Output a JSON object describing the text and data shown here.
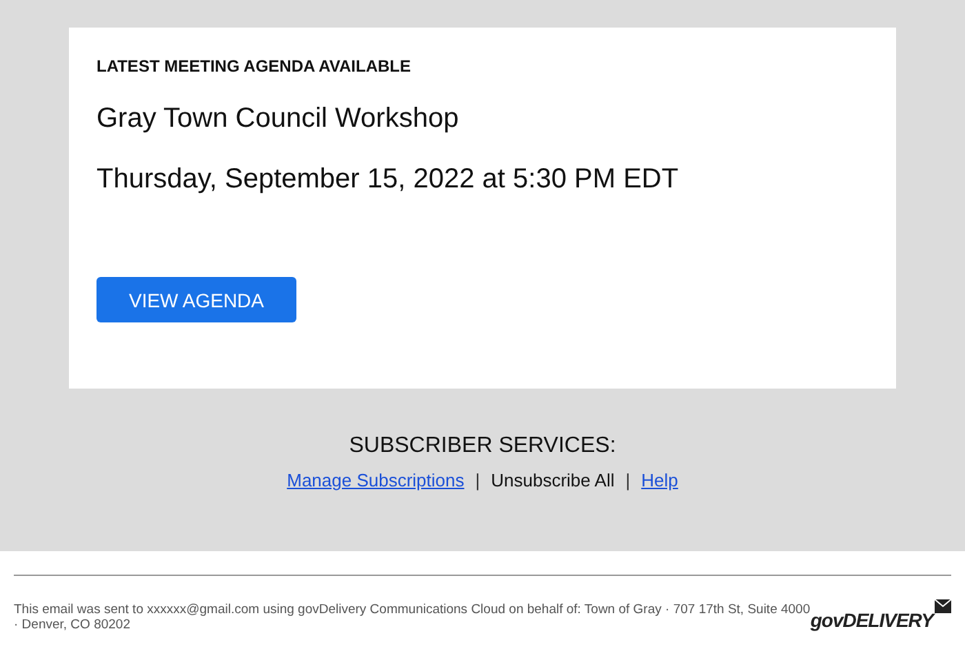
{
  "card": {
    "eyebrow": "LATEST MEETING AGENDA AVAILABLE",
    "title": "Gray Town Council Workshop",
    "datetime": "Thursday, September 15, 2022 at 5:30 PM EDT",
    "button": "VIEW AGENDA"
  },
  "subscriber": {
    "heading": "SUBSCRIBER SERVICES:",
    "links": [
      {
        "kind": "link",
        "text": "Manage Subscriptions"
      },
      {
        "kind": "separator",
        "text": "|"
      },
      {
        "kind": "plain",
        "text": "Unsubscribe All"
      },
      {
        "kind": "separator",
        "text": "|"
      },
      {
        "kind": "link",
        "text": "Help"
      }
    ]
  },
  "footer": {
    "notice": "This email was sent to xxxxxx@gmail.com using govDelivery Communications Cloud on behalf of: Town of Gray · 707 17th St, Suite 4000 · Denver, CO 80202",
    "logo": "govDELIVERY"
  }
}
